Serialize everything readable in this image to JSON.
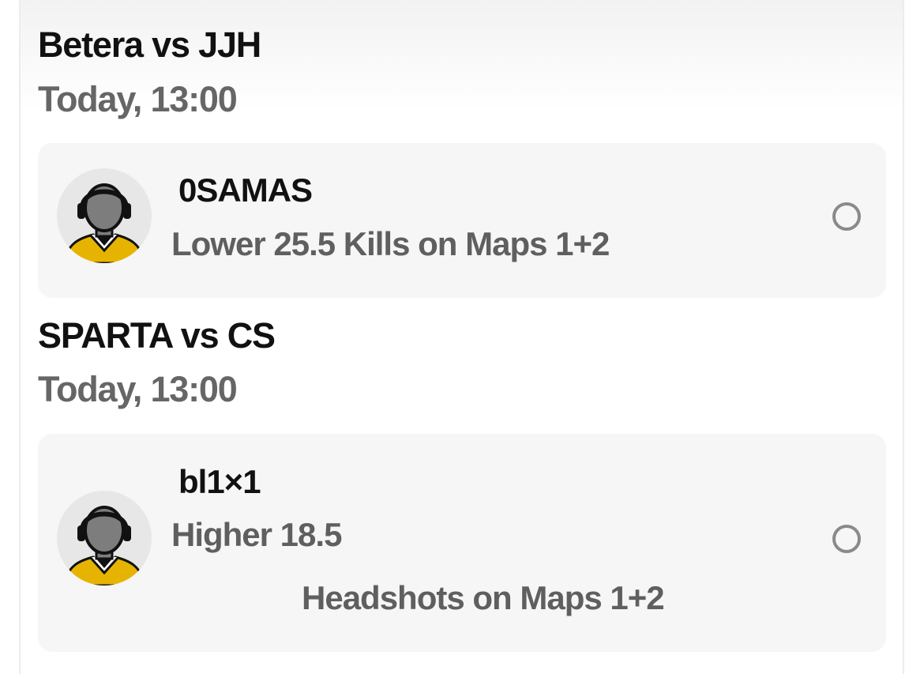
{
  "matches": [
    {
      "title": "Betera vs JJH",
      "time": "Today, 13:00",
      "pick": {
        "player": "0SAMAS",
        "line1": "Lower 25.5 Kills on Maps 1+2"
      }
    },
    {
      "title": "SPARTA vs CS",
      "time": "Today, 13:00",
      "pick": {
        "player": "bl1×1",
        "line1": "Higher 18.5",
        "line2": "Headshots on Maps 1+2"
      }
    }
  ],
  "icons": {
    "avatar": "player-avatar-icon",
    "radio": "radio-unselected-icon"
  },
  "colors": {
    "title": "#111111",
    "secondary": "#666666",
    "card_bg": "#f6f6f6",
    "jersey": "#e6b400",
    "radio_border": "#8a8a8a"
  }
}
